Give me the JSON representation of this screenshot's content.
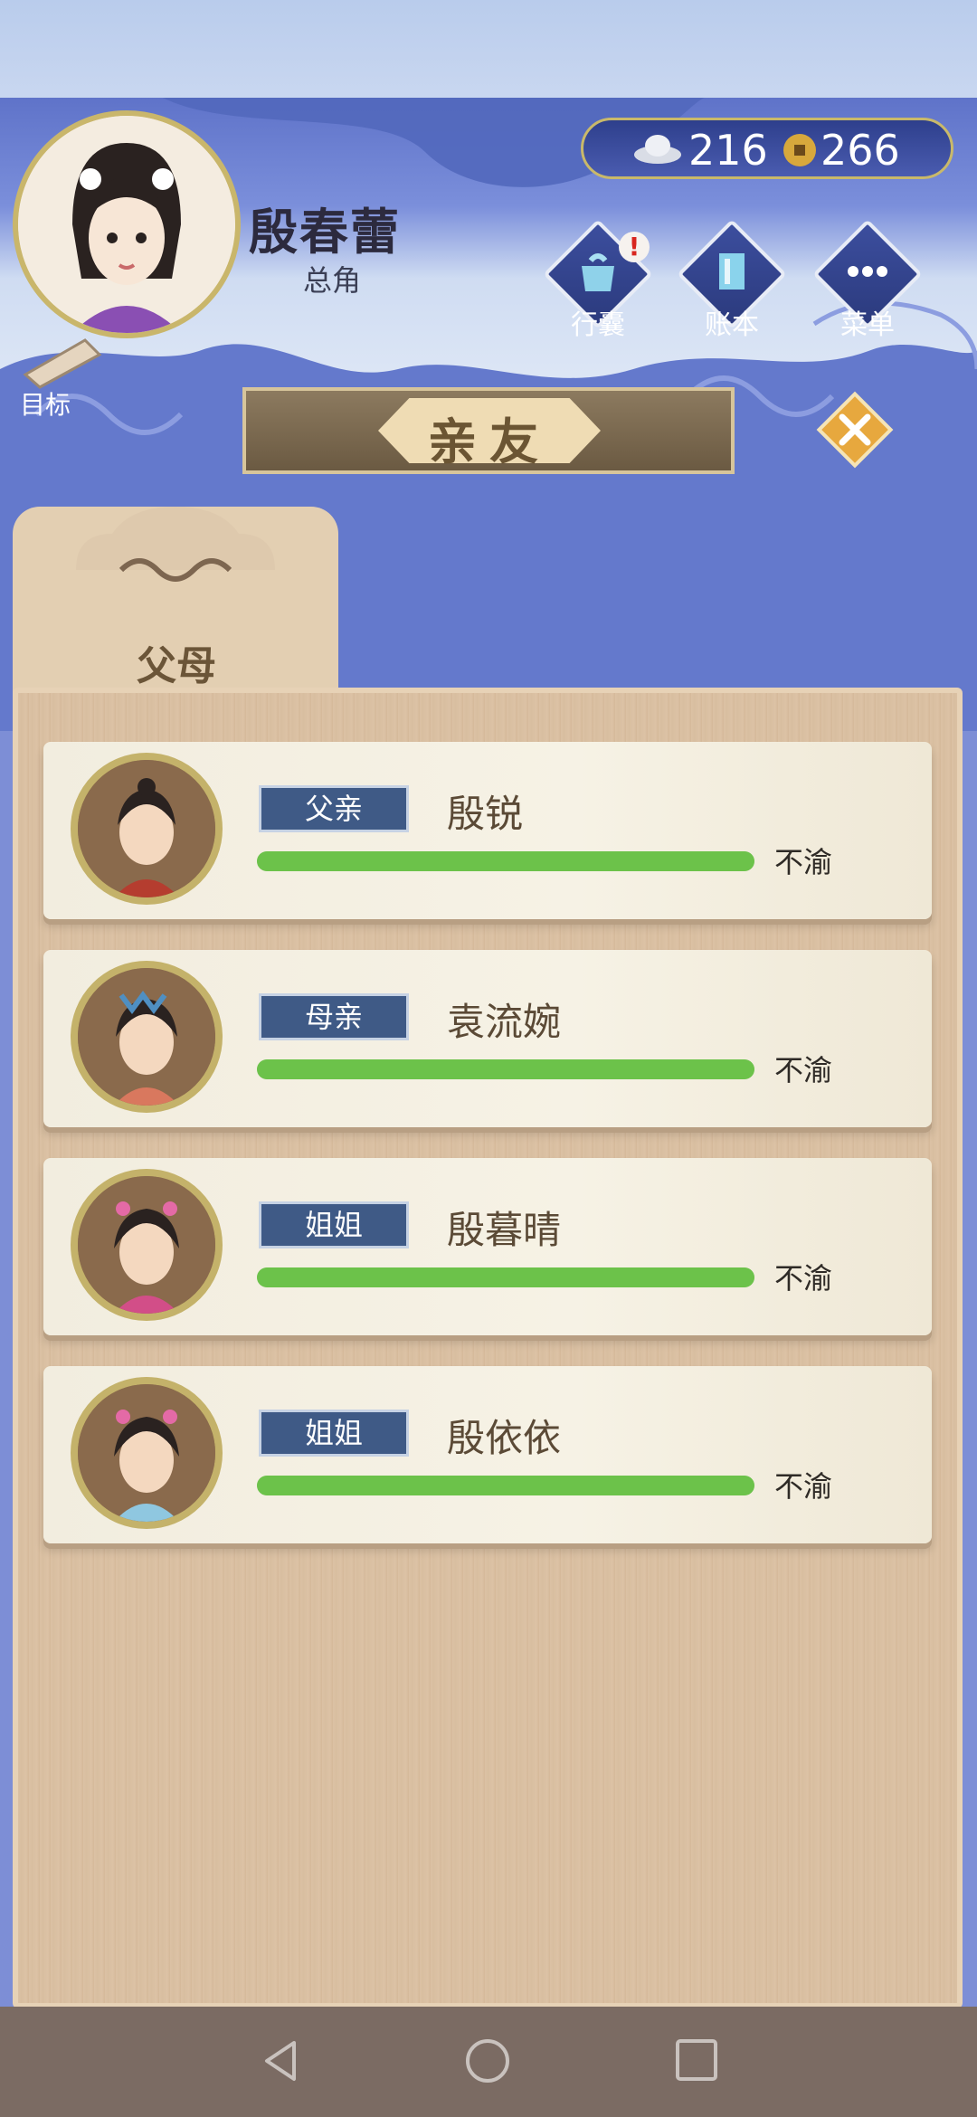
{
  "player": {
    "name": "殷春蕾",
    "title": "总角"
  },
  "currency": {
    "silver": "216",
    "copper": "266"
  },
  "menu": [
    {
      "id": "bag",
      "label": "行囊",
      "icon": "bag-icon",
      "alert": "!"
    },
    {
      "id": "ledger",
      "label": "账本",
      "icon": "ledger-icon"
    },
    {
      "id": "menu",
      "label": "菜单",
      "icon": "more-icon"
    }
  ],
  "target_label": "目标",
  "dialog": {
    "title": "亲友",
    "close_icon": "close-icon"
  },
  "tab": {
    "label": "父母"
  },
  "relatives": [
    {
      "relation": "父亲",
      "name": "殷锐",
      "mood": "不渝",
      "favor": 1.0
    },
    {
      "relation": "母亲",
      "name": "袁流婉",
      "mood": "不渝",
      "favor": 1.0
    },
    {
      "relation": "姐姐",
      "name": "殷暮晴",
      "mood": "不渝",
      "favor": 1.0
    },
    {
      "relation": "姐姐",
      "name": "殷依依",
      "mood": "不渝",
      "favor": 1.0
    }
  ],
  "colors": {
    "bar": "#6cc24a",
    "tag": "#3f5a86",
    "panel": "#dcc2a5"
  },
  "navigation": {
    "back": "back-icon",
    "home": "home-icon",
    "recent": "recent-apps-icon"
  }
}
